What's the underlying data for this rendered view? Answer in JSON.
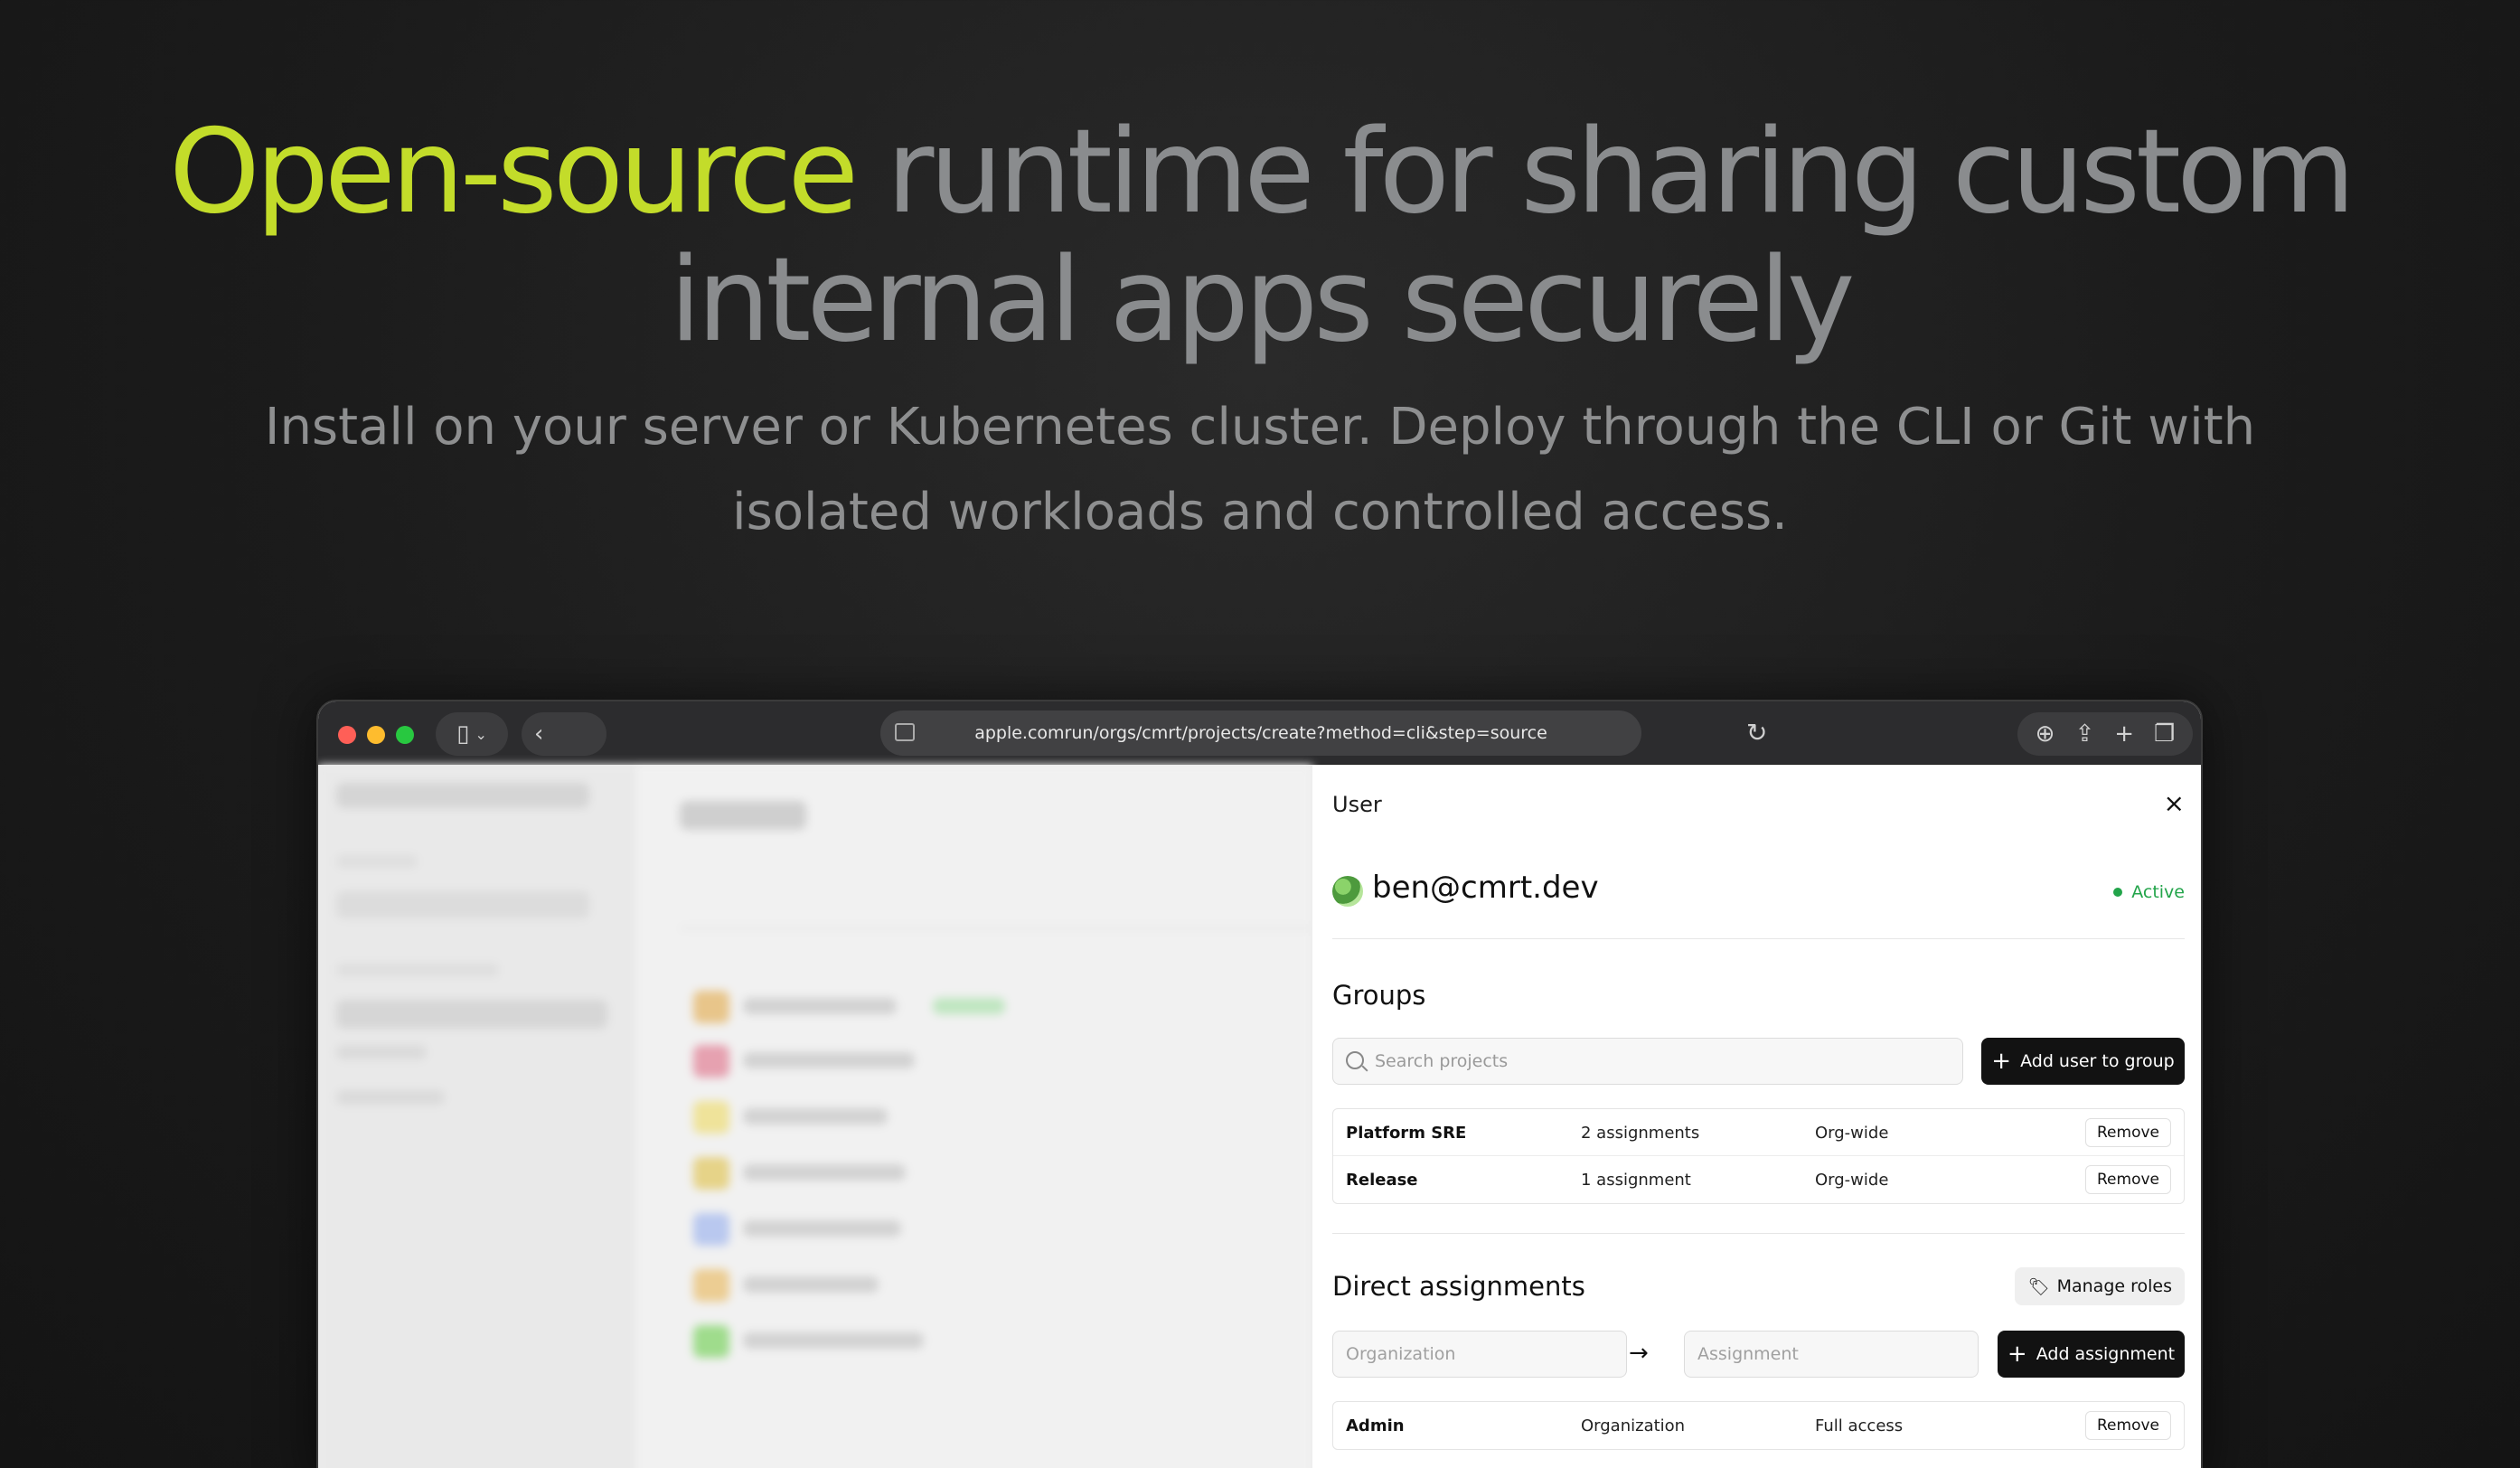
{
  "hero": {
    "headline_accent": "Open-source",
    "headline_rest": " runtime for sharing custom internal apps securely",
    "subheadline": "Install on your server or Kubernetes cluster. Deploy through the CLI or Git with isolated workloads and controlled access."
  },
  "browser": {
    "url": "apple.comrun/orgs/cmrt/projects/create?method=cli&step=source",
    "icons": [
      "sidebar-icon",
      "chevron-down-icon",
      "back-icon",
      "reload-icon",
      "download-icon",
      "share-icon",
      "new-tab-icon",
      "tabs-icon"
    ]
  },
  "panel": {
    "title": "User",
    "close": "×",
    "email": "ben@cmrt.dev",
    "status": "Active",
    "groups": {
      "title": "Groups",
      "search_placeholder": "Search projects",
      "add_button": "Add  user to group",
      "rows": [
        {
          "name": "Platform SRE",
          "assignments": "2 assignments",
          "scope": "Org-wide",
          "action": "Remove"
        },
        {
          "name": "Release",
          "assignments": "1 assignment",
          "scope": "Org-wide",
          "action": "Remove"
        }
      ]
    },
    "direct": {
      "title": "Direct assignments",
      "manage_button": "Manage roles",
      "org_placeholder": "Organization",
      "assignment_placeholder": "Assignment",
      "add_button": "Add  assignment",
      "rows": [
        {
          "name": "Admin",
          "type": "Organization",
          "access": "Full access",
          "action": "Remove"
        }
      ]
    }
  },
  "colors": {
    "accent": "#c3dc2a",
    "active": "#22a44a"
  }
}
